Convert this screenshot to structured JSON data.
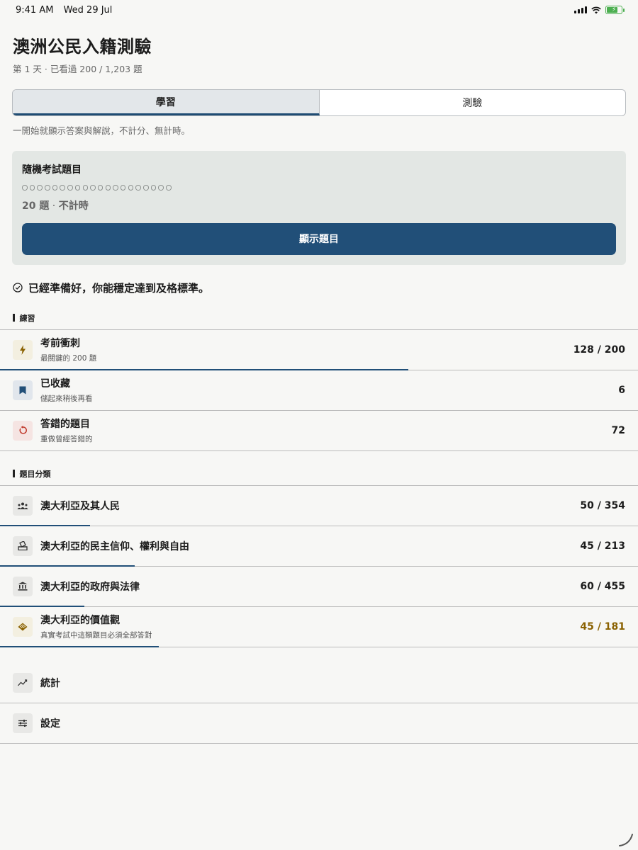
{
  "status": {
    "time": "9:41 AM",
    "date": "Wed 29 Jul"
  },
  "header": {
    "title": "澳洲公民入籍測驗",
    "subtitle": "第 1 天 · 已看過 200 / 1,203 題"
  },
  "tabs": [
    {
      "label": "學習",
      "active": true
    },
    {
      "label": "測驗",
      "active": false
    }
  ],
  "tab_note": "一開始就顯示答案與解說，不計分、無計時。",
  "random_card": {
    "title": "隨機考試題目",
    "dots_count": 20,
    "meta_count": "20 題",
    "meta_sep": " · ",
    "meta_timer": "不計時",
    "button_label": "顯示題目"
  },
  "readiness": "已經準備好，你能穩定達到及格標準。",
  "practice": {
    "section_label": "練習",
    "items": [
      {
        "label": "考前衝刺",
        "sublabel": "最關鍵的 200 題",
        "count": "128 / 200",
        "icon": "bolt-icon",
        "progress": 0.64
      },
      {
        "label": "已收藏",
        "sublabel": "儲起來稍後再看",
        "count": "6",
        "icon": "bookmark-icon",
        "progress": 0
      },
      {
        "label": "答錯的題目",
        "sublabel": "重做曾經答錯的",
        "count": "72",
        "icon": "retry-icon",
        "progress": 0
      }
    ]
  },
  "categories": {
    "section_label": "題目分類",
    "items": [
      {
        "label": "澳大利亞及其人民",
        "sublabel": "",
        "count": "50 / 354",
        "icon": "people-icon",
        "progress": 0.141
      },
      {
        "label": "澳大利亞的民主信仰、權利與自由",
        "sublabel": "",
        "count": "45 / 213",
        "icon": "ballot-icon",
        "progress": 0.211
      },
      {
        "label": "澳大利亞的政府與法律",
        "sublabel": "",
        "count": "60 / 455",
        "icon": "government-icon",
        "progress": 0.132
      },
      {
        "label": "澳大利亞的價值觀",
        "sublabel": "真實考試中這類題目必須全部答對",
        "count": "45 / 181",
        "icon": "values-icon",
        "progress": 0.249,
        "highlight_color": "#8a6100"
      }
    ]
  },
  "bottom": {
    "items": [
      {
        "label": "統計",
        "icon": "stats-icon"
      },
      {
        "label": "設定",
        "icon": "settings-icon"
      }
    ]
  },
  "colors": {
    "accent": "#214f78",
    "gold": "#8a6100",
    "background": "#f7f7f5"
  }
}
